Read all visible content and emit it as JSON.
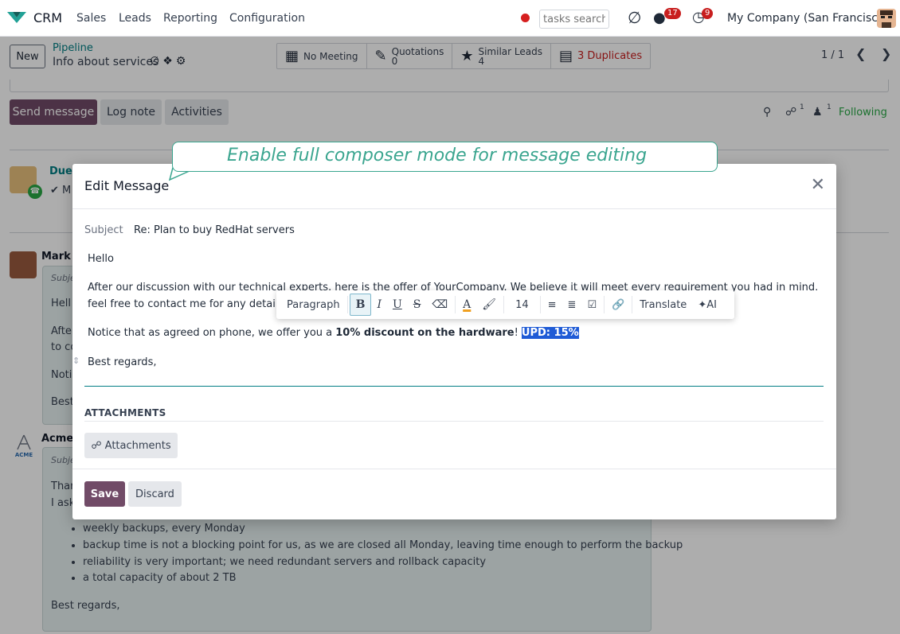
{
  "navbar": {
    "app": "CRM",
    "menu": [
      "Sales",
      "Leads",
      "Reporting",
      "Configuration"
    ],
    "search_placeholder": "tasks search",
    "messages_count": "17",
    "activities_count": "9",
    "company": "My Company (San Francisco)"
  },
  "control": {
    "new_label": "New",
    "breadcrumb_parent": "Pipeline",
    "breadcrumb_current": "Info about services",
    "smart_buttons": {
      "meeting": "No Meeting",
      "quotations_label": "Quotations",
      "quotations_count": "0",
      "similar_label": "Similar Leads",
      "similar_count": "4",
      "duplicates": "3 Duplicates"
    },
    "pager": "1 / 1"
  },
  "chatter": {
    "send_message": "Send message",
    "log_note": "Log note",
    "activities": "Activities",
    "attachments_count": "1",
    "followers_count": "1",
    "following": "Following",
    "activity_due": "Due",
    "activity_check": "✔ M",
    "msg1_author": "Mark D",
    "msg1_subject": "Subje",
    "msg1_lines": [
      "Hell",
      "Afte",
      "to co",
      "Noti",
      "Best"
    ],
    "msg2_author": "Acme (",
    "msg2_subject": "Subje",
    "msg2_lines": [
      "Thar",
      "I ask"
    ],
    "msg2_list": [
      "weekly backups, every Monday",
      "backup time is not a blocking point for us, as we are closed all Monday, leaving time enough to perform the backup",
      "reliability is very important; we need redundant servers and rollback capacity",
      "a total capacity of about 2 TB"
    ],
    "msg2_closing": "Best regards,"
  },
  "callout": {
    "text": "Enable full composer mode for message editing"
  },
  "modal": {
    "title": "Edit Message",
    "subject_label": "Subject",
    "subject_value": "Re: Plan to buy RedHat servers",
    "body": {
      "greeting": "Hello",
      "para1_line1": "After our discussion with our technical experts, here is the offer of YourCompany. We believe it will meet every requirement you had in mind. Please",
      "para1_line2": "feel free to contact me for any detail o",
      "para2_pre": "Notice that as agreed on phone, we offer you a ",
      "para2_bold": "10% discount on the hardware",
      "para2_post": "! ",
      "para2_selected": "UPD: 15%",
      "closing": "Best regards,"
    },
    "attachments_title": "ATTACHMENTS",
    "attachments_button": "Attachments",
    "save": "Save",
    "discard": "Discard"
  },
  "toolbar": {
    "paragraph": "Paragraph",
    "bold": "B",
    "italic": "I",
    "underline": "U",
    "strike": "S",
    "font_size": "14",
    "translate": "Translate",
    "ai": "AI"
  },
  "colors": {
    "brand": "#714b67",
    "link": "#017e84",
    "callout": "#3aa58f",
    "selection": "#1f5bd6"
  }
}
